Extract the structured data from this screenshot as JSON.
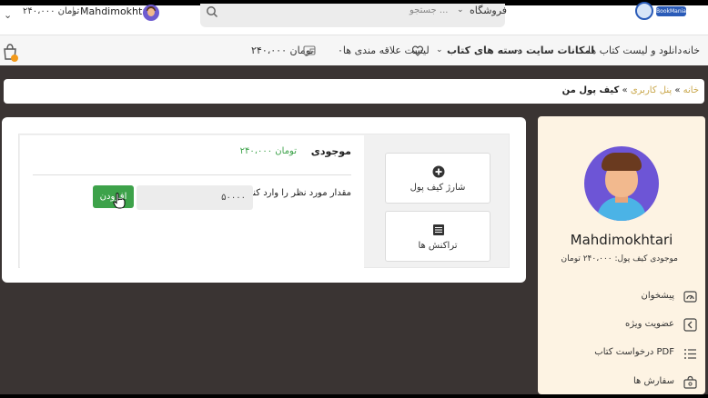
{
  "header": {
    "balance": "۲۴۰،۰۰۰ تومان",
    "separator": "|",
    "username": "Mahdimokhtari",
    "search_placeholder": "جستجو ...",
    "search_category": "فروشگاه",
    "logo_text": "BookMania"
  },
  "nav": {
    "items": [
      {
        "label": "خانه"
      },
      {
        "label": "دانلود و لیست کتاب ها"
      },
      {
        "label": "امکانات سایت"
      },
      {
        "label": "دسته های کتاب"
      },
      {
        "label": "لیست علاقه مندی ها۰"
      },
      {
        "label": "۲۴۰،۰۰۰ تومان"
      }
    ]
  },
  "breadcrumb": {
    "home": "خانه",
    "sep1": " » ",
    "panel": "پنل کاربری",
    "sep2": " » ",
    "current": "کیف پول من"
  },
  "wallet": {
    "balance_label": "موجودی",
    "balance_value": "۲۴۰،۰۰۰ تومان",
    "amount_label": "مقدار مورد نظر را وارد کنید",
    "amount_value": "۵۰۰۰۰",
    "add_button": "افزودن",
    "charge_label": "شارژ کیف پول",
    "transactions_label": "تراکنش ها"
  },
  "profile": {
    "name": "Mahdimokhtari",
    "wallet_balance": "موجودی کیف پول: ۲۴۰،۰۰۰ تومان",
    "menu": [
      {
        "label": "پیشخوان",
        "icon": "dashboard-icon"
      },
      {
        "label": "عضویت ویژه",
        "icon": "crown-icon"
      },
      {
        "label": "درخواست کتاب PDF",
        "icon": "list-icon"
      },
      {
        "label": "سفارش ها",
        "icon": "bag-icon"
      }
    ]
  },
  "colors": {
    "accent_green": "#3da24a",
    "breadcrumb_link": "#c9a74b",
    "profile_bg": "#fdf3e3"
  }
}
